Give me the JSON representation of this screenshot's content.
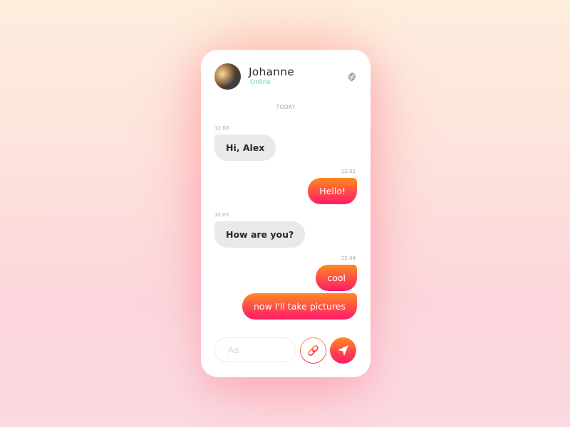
{
  "contact": {
    "name": "Johanne",
    "status": "Online",
    "status_color": "#5fd9a0"
  },
  "header": {
    "settings_icon": "gear-icon"
  },
  "chat": {
    "date_separator": "TODAY",
    "messages": [
      {
        "time": "12:00",
        "text": "Hi, Alex",
        "direction": "received"
      },
      {
        "time": "12:02",
        "text": "Hello!",
        "direction": "sent"
      },
      {
        "time": "12:03",
        "text": "How are you?",
        "direction": "received"
      },
      {
        "time": "12:04",
        "text": "cool",
        "direction": "sent"
      },
      {
        "time": "",
        "text": "now I'll take pictures",
        "direction": "sent"
      }
    ]
  },
  "composer": {
    "placeholder": "Aa",
    "value": "",
    "attach_icon": "link-icon",
    "send_icon": "send-icon"
  },
  "colors": {
    "gradient_start": "#ff8a1f",
    "gradient_end": "#ff1a6b",
    "received_bubble": "#e9e9e9"
  }
}
